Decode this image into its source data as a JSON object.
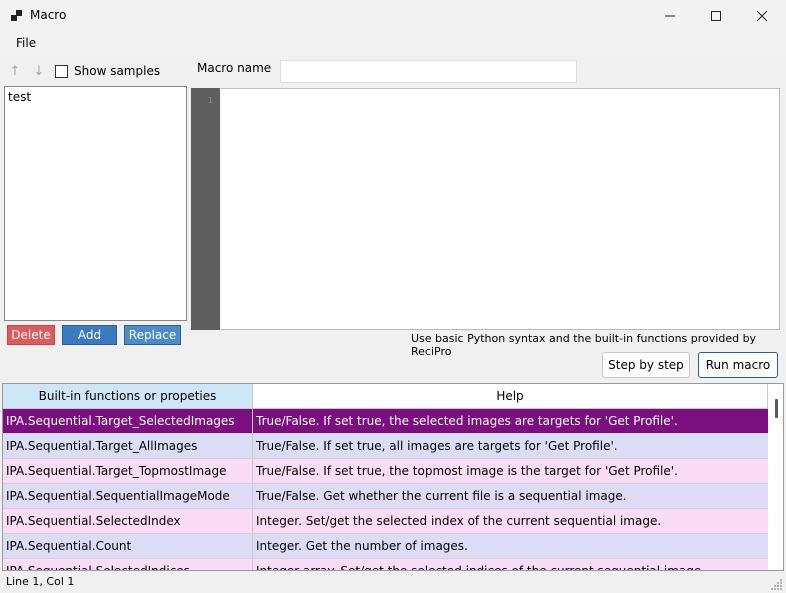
{
  "window": {
    "title": "Macro",
    "minimize_icon": "minimize-icon",
    "maximize_icon": "maximize-icon",
    "close_icon": "close-icon"
  },
  "menu": {
    "file": "File"
  },
  "sidebar": {
    "up_icon": "↑",
    "down_icon": "↓",
    "show_samples": "Show samples",
    "items": [
      "test"
    ],
    "delete": "Delete",
    "add": "Add",
    "replace": "Replace"
  },
  "editor": {
    "macro_name_label": "Macro name",
    "macro_name_value": "",
    "line_number": "1",
    "hint": "Use basic Python syntax and the built-in functions provided by ReciPro",
    "step_by_step": "Step by step",
    "run_macro": "Run macro"
  },
  "table": {
    "headers": [
      "Built-in functions or propeties",
      "Help"
    ],
    "rows": [
      [
        "IPA.Sequential.Target_SelectedImages",
        "True/False.  If set true, the selected images are targets for 'Get Profile'."
      ],
      [
        "IPA.Sequential.Target_AllImages",
        "True/False.  If set true, all images are targets for 'Get Profile'."
      ],
      [
        "IPA.Sequential.Target_TopmostImage",
        "True/False.  If set true, the topmost image is the target for 'Get Profile'."
      ],
      [
        "IPA.Sequential.SequentialImageMode",
        "True/False.  Get whether the current file is a sequential image."
      ],
      [
        "IPA.Sequential.SelectedIndex",
        "Integer.  Set/get the selected index of the current sequential image."
      ],
      [
        "IPA.Sequential.Count",
        "Integer.  Get the number of images."
      ],
      [
        "IPA.Sequential.SelectedIndices",
        "Integer array.  Set/get the selected indices of the current sequential image."
      ]
    ]
  },
  "status": {
    "cursor": "Line 1, Col 1"
  },
  "colors": {
    "selected_row": "#7b0f7f",
    "lavender_row": "#dcdcf6",
    "pink_row": "#fadcf6",
    "header_selected": "#cde7f9"
  }
}
